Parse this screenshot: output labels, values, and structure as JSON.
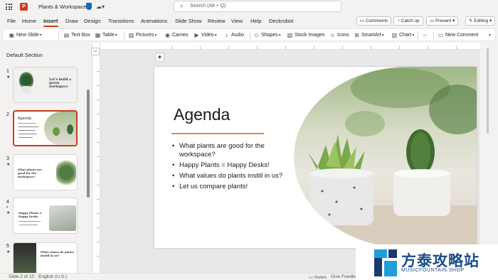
{
  "titlebar": {
    "app_letter": "P",
    "doc_title": "Plants & Workspace",
    "search_placeholder": "Search (Alt + Q)"
  },
  "menu": {
    "tabs": [
      "File",
      "Home",
      "Insert",
      "Draw",
      "Design",
      "Transitions",
      "Animations",
      "Slide Show",
      "Review",
      "View",
      "Help",
      "Deckrobot"
    ],
    "active": "Insert",
    "comments_label": "Comments",
    "catchup_label": "Catch up",
    "present_label": "Present",
    "editing_label": "Editing"
  },
  "ribbon": {
    "new_slide": "New Slide",
    "text_box": "Text Box",
    "table": "Table",
    "pictures": "Pictures",
    "cameo": "Cameo",
    "video": "Video",
    "audio": "Audio",
    "shapes": "Shapes",
    "stock_images": "Stock Images",
    "icons": "Icons",
    "smartart": "SmartArt",
    "chart": "Chart",
    "new_comment": "New Comment"
  },
  "thumbnails": {
    "section": "Default Section",
    "slides": [
      {
        "num": "1",
        "title": "Let's build a green workspace"
      },
      {
        "num": "2",
        "title": "Agenda"
      },
      {
        "num": "3",
        "title": "What plants are good for the workspace?"
      },
      {
        "num": "4",
        "title": "Happy Plants = Happy Desks"
      },
      {
        "num": "5",
        "title": "What values do plants instill in us?"
      }
    ]
  },
  "slide": {
    "title": "Agenda",
    "bullets": [
      "What plants are good for the workspace?",
      "Happy Plants = Happy Desks!",
      "What values do plants instill in us?",
      "Let us compare plants!"
    ]
  },
  "status": {
    "slide_counter": "Slide 2 of 10",
    "language": "English (U.S.)",
    "notes": "Notes",
    "feedback": "Give Feedback"
  },
  "watermark": {
    "cn": "方泰攻略站",
    "en": "MUSICFOUNTAIN.SHOP"
  },
  "colors": {
    "accent": "#c43e1c",
    "title_underline": "#e08b4c"
  }
}
